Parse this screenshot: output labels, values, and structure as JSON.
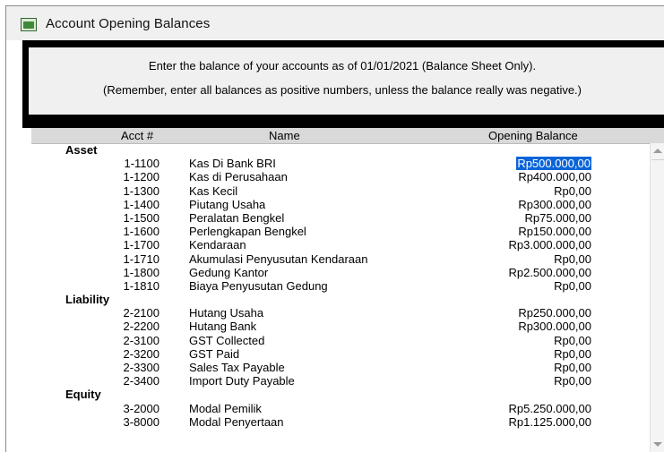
{
  "window": {
    "title": "Account Opening Balances"
  },
  "instructions": {
    "line1": "Enter the balance of your accounts as of 01/01/2021 (Balance Sheet Only).",
    "line2": "(Remember, enter all balances as positive numbers, unless the balance really was negative.)"
  },
  "table": {
    "headers": {
      "acct": "Acct #",
      "name": "Name",
      "balance": "Opening Balance"
    },
    "rows": [
      {
        "group": "Asset"
      },
      {
        "acct": "1-1100",
        "name": "Kas Di Bank BRI",
        "balance": "Rp500.000,00",
        "selected": true
      },
      {
        "acct": "1-1200",
        "name": "Kas di Perusahaan",
        "balance": "Rp400.000,00"
      },
      {
        "acct": "1-1300",
        "name": "Kas Kecil",
        "balance": "Rp0,00"
      },
      {
        "acct": "1-1400",
        "name": "Piutang Usaha",
        "balance": "Rp300.000,00"
      },
      {
        "acct": "1-1500",
        "name": "Peralatan Bengkel",
        "balance": "Rp75.000,00"
      },
      {
        "acct": "1-1600",
        "name": "Perlengkapan Bengkel",
        "balance": "Rp150.000,00"
      },
      {
        "acct": "1-1700",
        "name": "Kendaraan",
        "balance": "Rp3.000.000,00"
      },
      {
        "acct": "1-1710",
        "name": "Akumulasi Penyusutan Kendaraan",
        "balance": "Rp0,00"
      },
      {
        "acct": "1-1800",
        "name": "Gedung Kantor",
        "balance": "Rp2.500.000,00"
      },
      {
        "acct": "1-1810",
        "name": "Biaya Penyusutan Gedung",
        "balance": "Rp0,00"
      },
      {
        "group": "Liability"
      },
      {
        "acct": "2-2100",
        "name": "Hutang Usaha",
        "balance": "Rp250.000,00"
      },
      {
        "acct": "2-2200",
        "name": "Hutang Bank",
        "balance": "Rp300.000,00"
      },
      {
        "acct": "2-3100",
        "name": "GST Collected",
        "balance": "Rp0,00"
      },
      {
        "acct": "2-3200",
        "name": "GST Paid",
        "balance": "Rp0,00"
      },
      {
        "acct": "2-3300",
        "name": "Sales Tax Payable",
        "balance": "Rp0,00"
      },
      {
        "acct": "2-3400",
        "name": "Import Duty Payable",
        "balance": "Rp0,00"
      },
      {
        "group": "Equity"
      },
      {
        "acct": "3-2000",
        "name": "Modal Pemilik",
        "balance": "Rp5.250.000,00"
      },
      {
        "acct": "3-8000",
        "name": "Modal Penyertaan",
        "balance": "Rp1.125.000,00"
      }
    ]
  },
  "icons": {
    "title": "account-window-icon",
    "scroll_up": "chevron-up-icon",
    "scroll_down": "chevron-down-icon"
  },
  "colors": {
    "selection": "#0a64d8",
    "header_bg": "#d9d9d9",
    "band": "#000000"
  }
}
